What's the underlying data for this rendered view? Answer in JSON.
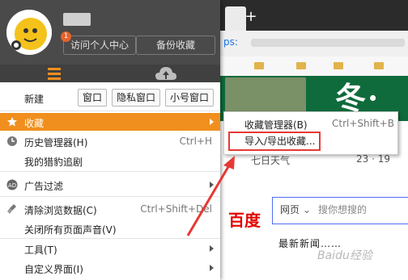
{
  "browser": {
    "new_tab": "+",
    "address": "ps:",
    "banner_text": "冬·清",
    "weather_label": "七日天气",
    "temperature": "23 · 19",
    "baidu_logo": "百度",
    "search_scope": "网页",
    "search_placeholder": "搜你想搜的",
    "news_line": "最新新闻……",
    "watermark": "Baidu经验"
  },
  "panel": {
    "header": {
      "user_center": "访问个人中心",
      "backup": "备份收藏",
      "notification_count": "1"
    },
    "new_label": "新建",
    "new_buttons": [
      "窗口",
      "隐私窗口",
      "小号窗口"
    ],
    "items": [
      {
        "label": "收藏",
        "shortcut": "",
        "icon": "star-icon",
        "submenu": true,
        "highlight": true
      },
      {
        "label": "历史管理器(H)",
        "shortcut": "Ctrl+H",
        "icon": "clock-icon",
        "submenu": false,
        "highlight": false
      },
      {
        "label": "我的猎豹追剧",
        "shortcut": "",
        "icon": "",
        "submenu": false,
        "highlight": false
      },
      {
        "label": "广告过滤",
        "shortcut": "",
        "icon": "adblock-icon",
        "submenu": true,
        "highlight": false
      },
      {
        "label": "清除浏览数据(C)",
        "shortcut": "Ctrl+Shift+Del",
        "icon": "broom-icon",
        "submenu": false,
        "highlight": false
      },
      {
        "label": "关闭所有页面声音(V)",
        "shortcut": "",
        "icon": "",
        "submenu": false,
        "highlight": false
      },
      {
        "label": "工具(T)",
        "shortcut": "",
        "icon": "",
        "submenu": true,
        "highlight": false
      },
      {
        "label": "自定义界面(I)",
        "shortcut": "",
        "icon": "",
        "submenu": true,
        "highlight": false
      }
    ]
  },
  "submenu": {
    "bookmark_manager": "收藏管理器(B)",
    "bookmark_manager_shortcut": "Ctrl+Shift+B",
    "import_export": "导入/导出收藏..."
  },
  "colors": {
    "highlight": "#f08f1e",
    "header_bg": "#4a4a4a",
    "annotation_red": "#e53935"
  }
}
